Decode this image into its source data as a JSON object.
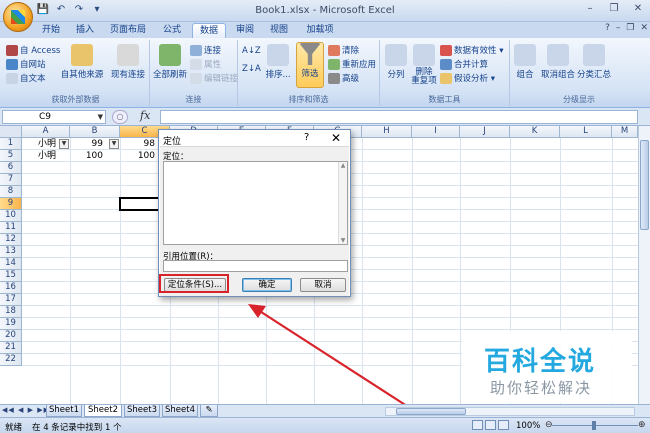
{
  "window": {
    "title": "Book1.xlsx - Microsoft Excel",
    "minimize": "–",
    "restore": "❐",
    "close": "✕"
  },
  "qat": {
    "save": "💾",
    "undo": "↶",
    "redo": "↷",
    "customize": "▾"
  },
  "tabs": [
    {
      "label": "开始"
    },
    {
      "label": "插入"
    },
    {
      "label": "页面布局"
    },
    {
      "label": "公式"
    },
    {
      "label": "数据"
    },
    {
      "label": "审阅"
    },
    {
      "label": "视图"
    },
    {
      "label": "加载项"
    }
  ],
  "active_tab_index": 4,
  "tab_right": {
    "help": "?",
    "min": "–",
    "restore": "❐",
    "close": "✕"
  },
  "ribbon": {
    "groups": {
      "external": {
        "label": "获取外部数据",
        "access": "自 Access",
        "web": "自网站",
        "text": "自文本",
        "other": "自其他来源",
        "existing": "现有连接"
      },
      "connections": {
        "label": "连接",
        "refresh": "全部刷新",
        "conn": "连接",
        "props": "属性",
        "edit": "编辑链接"
      },
      "sort": {
        "label": "排序和筛选",
        "az": "A↓Z",
        "za": "Z↓A",
        "sort": "排序...",
        "filter": "筛选",
        "clear": "清除",
        "reapply": "重新应用",
        "advanced": "高级"
      },
      "tools": {
        "label": "数据工具",
        "split": "分列",
        "dedupe": "删除\n重复项",
        "validate": "数据有效性 ▾",
        "consolidate": "合并计算",
        "whatif": "假设分析 ▾"
      },
      "outline": {
        "label": "分级显示",
        "group": "组合",
        "ungroup": "取消组合",
        "subtotal": "分类汇总"
      }
    }
  },
  "formula_bar": {
    "name_box": "C9",
    "fx": "fx",
    "value": ""
  },
  "columns": [
    "A",
    "B",
    "C",
    "D",
    "E",
    "F",
    "G",
    "H",
    "I",
    "J",
    "K",
    "L",
    "M"
  ],
  "rows": [
    "1",
    "2",
    "3",
    "4",
    "5",
    "6",
    "7",
    "8",
    "9",
    "10",
    "11",
    "12",
    "13",
    "14",
    "15",
    "16",
    "17",
    "18",
    "19",
    "20",
    "21",
    "22"
  ],
  "cells": {
    "a1": "小明",
    "b1": "99",
    "c1": "98",
    "a5": "小明",
    "b5": "100",
    "c5": "100"
  },
  "dialog": {
    "title": "定位",
    "help": "?",
    "close": "✕",
    "goto_label": "定位：",
    "reference_label": "引用位置(R)：",
    "reference_value": "",
    "special_button": "定位条件(S)...",
    "ok_button": "确定",
    "cancel_button": "取消"
  },
  "watermark": {
    "title": "百科全说",
    "subtitle": "助你轻松解决"
  },
  "sheets": [
    {
      "label": "Sheet1"
    },
    {
      "label": "Sheet2"
    },
    {
      "label": "Sheet3"
    },
    {
      "label": "Sheet4"
    }
  ],
  "active_sheet_index": 1,
  "sheet_nav": "◀◀ ◀ ▶ ▶▶",
  "status": {
    "mode": "就绪",
    "message": "在 4 条记录中找到 1 个",
    "zoom": "100%",
    "zoom_minus": "⊖",
    "zoom_plus": "⊕"
  },
  "colors": {
    "accent": "#15428b",
    "highlight": "#d9232a",
    "watermark": "#23a8e0"
  }
}
